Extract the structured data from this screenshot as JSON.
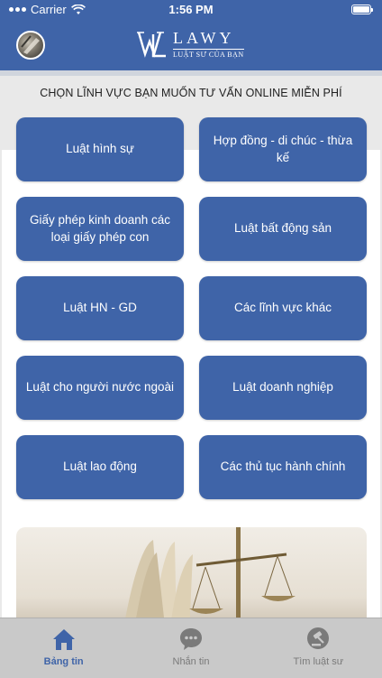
{
  "status_bar": {
    "carrier": "Carrier",
    "time": "1:56 PM"
  },
  "header": {
    "logo_name": "LAWY",
    "logo_tagline": "LUẬT SƯ CỦA BẠN"
  },
  "main": {
    "section_title": "CHỌN LĨNH VỰC BẠN MUỐN TƯ VẤN ONLINE MIỄN PHÍ",
    "categories": [
      "Luật hình sự",
      "Hợp đồng - di chúc - thừa kế",
      "Giấy phép kinh doanh các loại giấy phép con",
      "Luật bất động sản",
      "Luật HN - GD",
      "Các lĩnh vực khác",
      "Luật cho người nước ngoài",
      "Luật doanh nghiệp",
      "Luật lao động",
      "Các thủ tục hành chính"
    ]
  },
  "tab_bar": {
    "tabs": [
      {
        "label": "Bảng tin",
        "icon": "home-icon",
        "active": true
      },
      {
        "label": "Nhắn tin",
        "icon": "chat-icon",
        "active": false
      },
      {
        "label": "Tìm luật sư",
        "icon": "gavel-icon",
        "active": false
      }
    ]
  },
  "colors": {
    "primary": "#3f64a8",
    "tab_bar_bg": "#c9c9c9",
    "content_bg": "#ffffff"
  }
}
